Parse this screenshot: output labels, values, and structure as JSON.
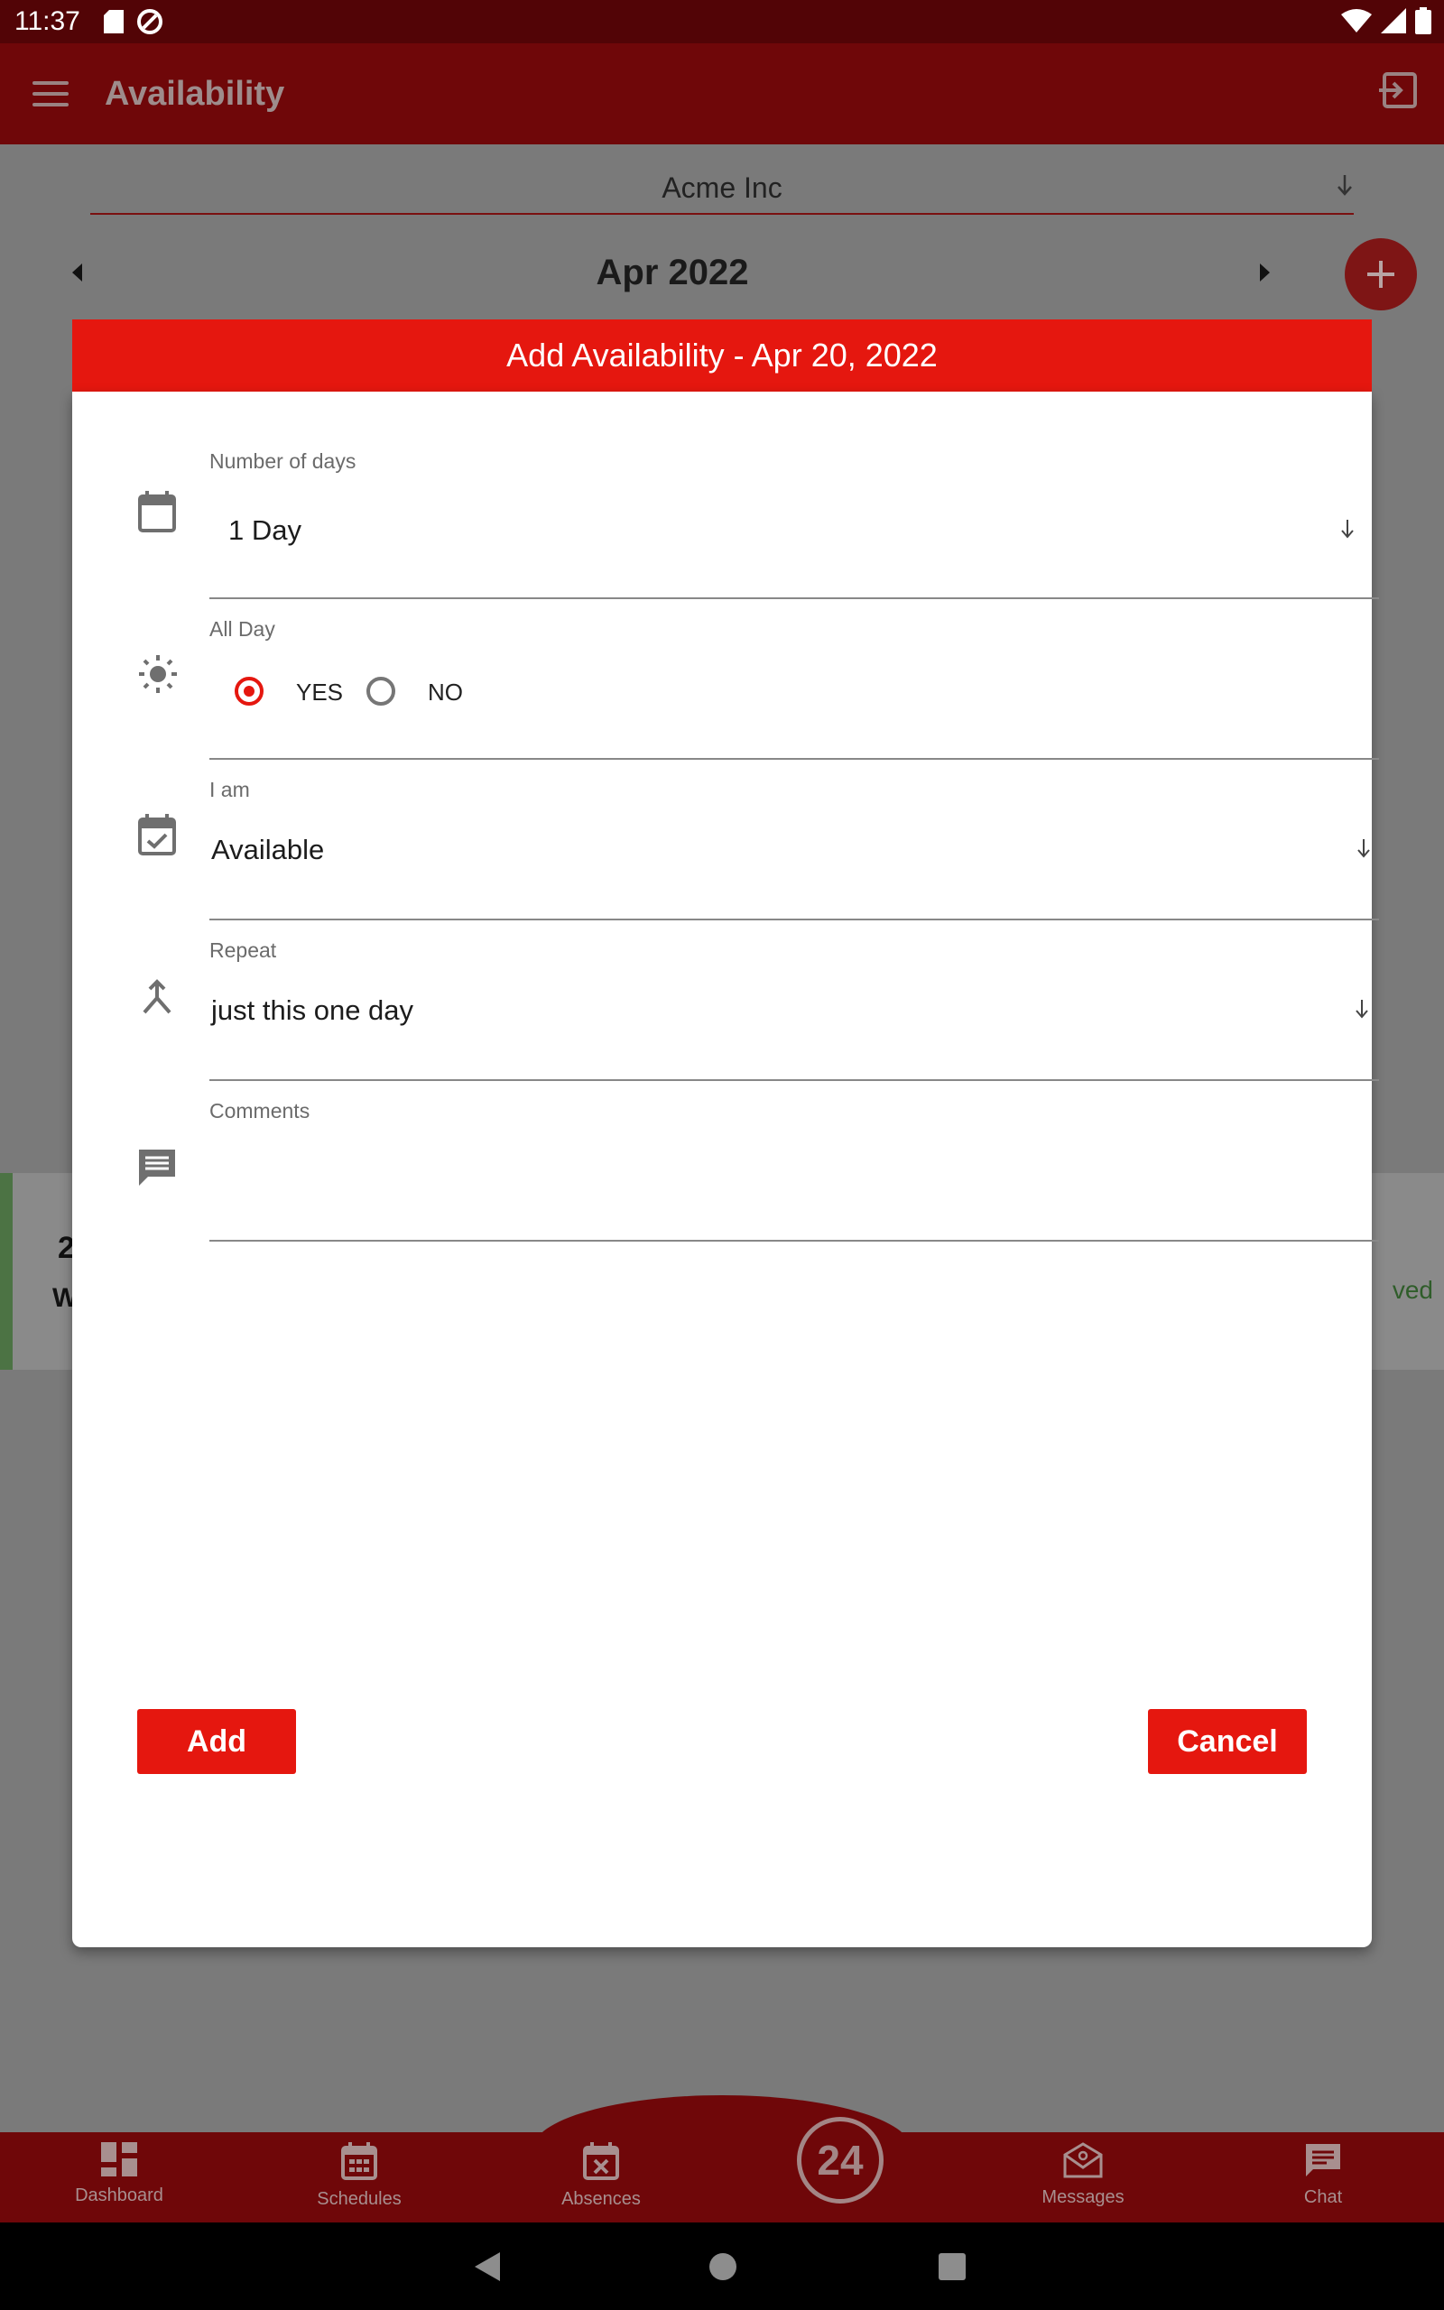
{
  "status_bar": {
    "time": "11:37"
  },
  "app_bar": {
    "title": "Availability"
  },
  "company_select": {
    "value": "Acme Inc"
  },
  "month_nav": {
    "label": "Apr 2022"
  },
  "background_card": {
    "line1": "2",
    "line2": "W",
    "status": "ved"
  },
  "dialog": {
    "title": "Add Availability - Apr 20, 2022",
    "fields": {
      "days": {
        "label": "Number of days",
        "value": "1 Day"
      },
      "all_day": {
        "label": "All Day",
        "yes": "YES",
        "no": "NO",
        "selected": "YES"
      },
      "i_am": {
        "label": "I am",
        "value": "Available"
      },
      "repeat": {
        "label": "Repeat",
        "value": "just this one day"
      },
      "comments": {
        "label": "Comments",
        "value": ""
      }
    },
    "add_label": "Add",
    "cancel_label": "Cancel"
  },
  "bottom_nav": {
    "items": [
      {
        "label": "Dashboard",
        "icon": "dashboard-icon"
      },
      {
        "label": "Schedules",
        "icon": "calendar-icon"
      },
      {
        "label": "Absences",
        "icon": "calendar-x-icon"
      },
      {
        "label": "Messages",
        "icon": "mail-icon"
      },
      {
        "label": "Chat",
        "icon": "chat-icon"
      }
    ],
    "center_label": "24"
  },
  "colors": {
    "primary": "#e5170f",
    "app_bar": "#6f0709",
    "status_bar": "#520406"
  }
}
